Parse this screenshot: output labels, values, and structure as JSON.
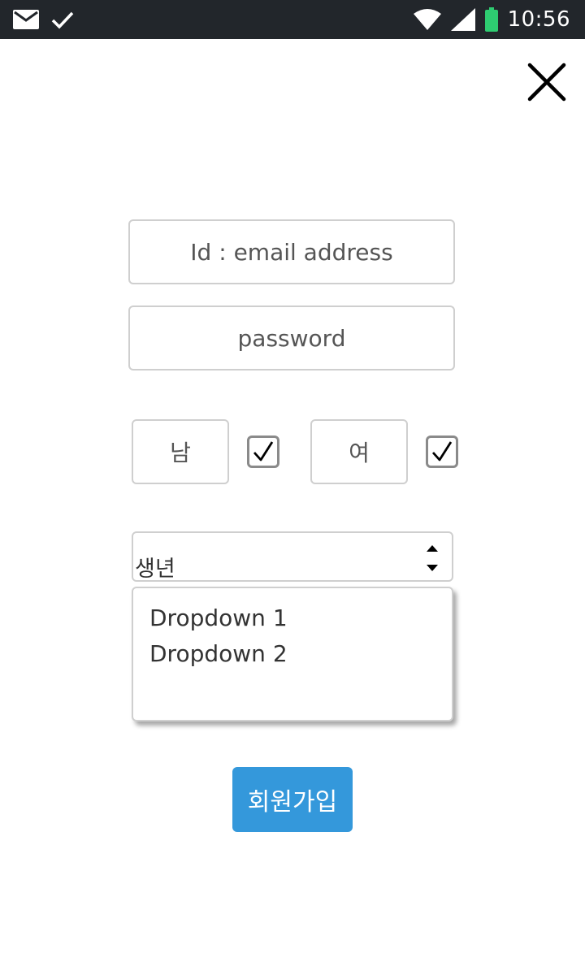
{
  "status_bar": {
    "time": "10:56",
    "icons": [
      "mail-icon",
      "check-icon",
      "wifi-icon",
      "signal-icon",
      "battery-icon"
    ],
    "battery_color": "#2ecc71"
  },
  "form": {
    "email_placeholder": "Id : email address",
    "password_placeholder": "password",
    "gender": {
      "male_label": "남",
      "female_label": "여",
      "male_checked": true,
      "female_checked": true
    },
    "birth_year": {
      "label": "생년",
      "options": [
        "Dropdown 1",
        "Dropdown 2"
      ]
    },
    "submit_label": "회원가입"
  },
  "colors": {
    "status_bar_bg": "#22262b",
    "accent": "#3498db",
    "border": "#cfcfcf"
  }
}
